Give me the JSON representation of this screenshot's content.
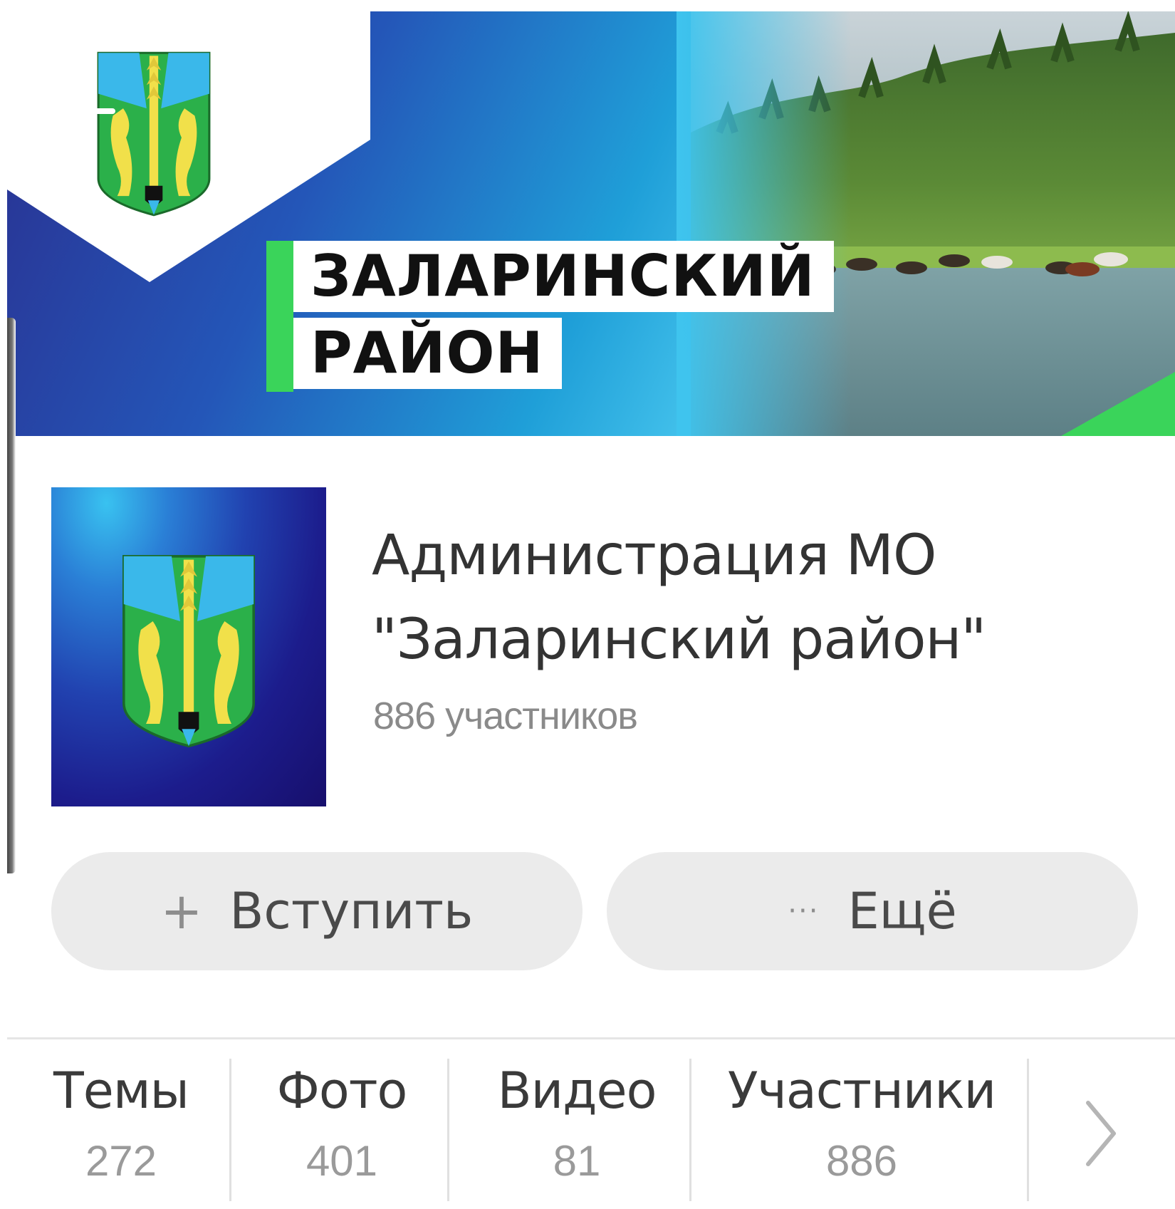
{
  "cover": {
    "title_line1": "ЗАЛАРИНСКИЙ",
    "title_line2": "РАЙОН",
    "accent_color": "#3ad45a",
    "back_icon": "arrow-left-icon"
  },
  "group": {
    "name": "Администрация МО \"Заларинский район\"",
    "members_text": "886 участников"
  },
  "actions": {
    "join_icon": "+",
    "join_label": "Вступить",
    "more_icon": "···",
    "more_label": "Ещё"
  },
  "tabs": [
    {
      "label": "Темы",
      "count": "272"
    },
    {
      "label": "Фото",
      "count": "401"
    },
    {
      "label": "Видео",
      "count": "81"
    },
    {
      "label": "Участники",
      "count": "886"
    }
  ],
  "tabs_next_icon": "chevron-right-icon"
}
